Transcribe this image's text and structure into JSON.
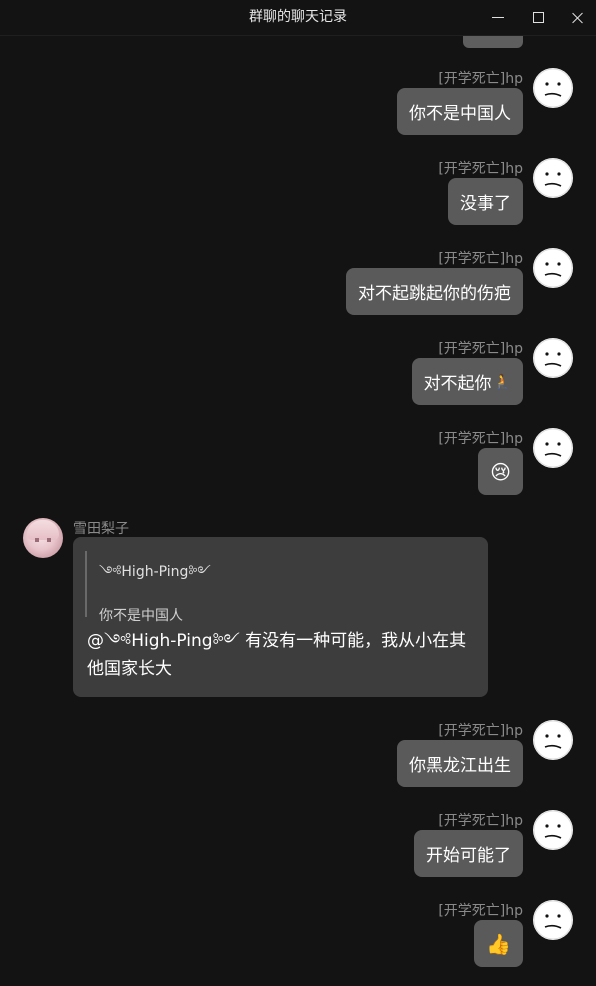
{
  "window": {
    "title": "群聊的聊天记录",
    "controls": {
      "minimize": "minimize-icon",
      "maximize": "maximize-icon",
      "close": "close-icon"
    }
  },
  "messages": [
    {
      "side": "right",
      "name": "[开学死亡]hp",
      "text": "你不是中国人"
    },
    {
      "side": "right",
      "name": "[开学死亡]hp",
      "text": "没事了"
    },
    {
      "side": "right",
      "name": "[开学死亡]hp",
      "text": "对不起跳起你的伤疤"
    },
    {
      "side": "right",
      "name": "[开学死亡]hp",
      "text": "对不起你",
      "emoji": "🧎"
    },
    {
      "side": "right",
      "name": "[开学死亡]hp",
      "emoji": "😢"
    },
    {
      "side": "left",
      "name": "雪田梨子",
      "quote": {
        "name": "༺High-Ping༻",
        "text": "你不是中国人"
      },
      "text": "@༺High-Ping༻ 有没有一种可能，我从小在其他国家长大"
    },
    {
      "side": "right",
      "name": "[开学死亡]hp",
      "text": "你黑龙江出生"
    },
    {
      "side": "right",
      "name": "[开学死亡]hp",
      "text": "开始可能了"
    },
    {
      "side": "right",
      "name": "[开学死亡]hp",
      "emoji": "👍"
    }
  ],
  "colors": {
    "background": "#131313",
    "self_bubble": "#5a5a5a",
    "other_bubble": "#3d3d3d",
    "name_text": "#8a8a8a"
  }
}
